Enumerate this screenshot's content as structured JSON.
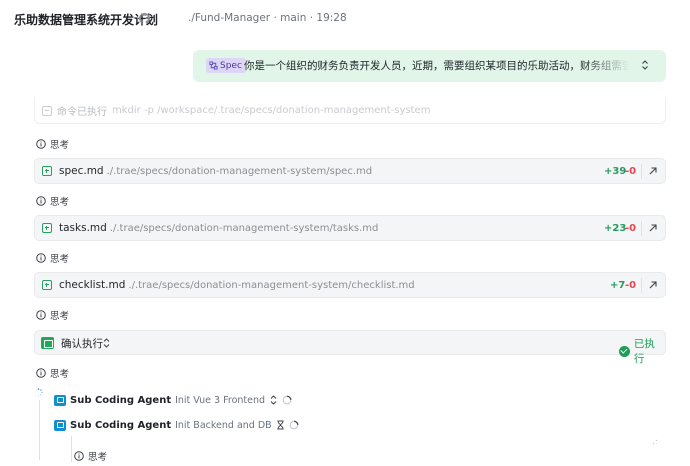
{
  "header": {
    "title": "乐助数据管理系统开发计划",
    "meta": "./Fund-Manager · main · 19:28"
  },
  "spec_message": {
    "tag": "Spec",
    "text": "你是一个组织的财务负责开发人员，近期，需要组织某项目的乐助活动，财务组需要记录"
  },
  "command": {
    "label": "命令已执行",
    "path": "mkdir -p /workspace/.trae/specs/donation-management-system"
  },
  "think_label": "思考",
  "files": [
    {
      "name": "spec.md",
      "path": "./.trae/specs/donation-management-system/spec.md",
      "added": "+39",
      "removed": "-0"
    },
    {
      "name": "tasks.md",
      "path": "./.trae/specs/donation-management-system/tasks.md",
      "added": "+23",
      "removed": "-0"
    },
    {
      "name": "checklist.md",
      "path": "./.trae/specs/donation-management-system/checklist.md",
      "added": "+7",
      "removed": "-0"
    }
  ],
  "confirm": {
    "label": "确认执行",
    "status": "已执行"
  },
  "agents": [
    {
      "name": "Sub Coding Agent",
      "task": "Init Vue 3 Frontend"
    },
    {
      "name": "Sub Coding Agent",
      "task": "Init Backend and DB"
    }
  ],
  "colors": {
    "added": "#249b5e",
    "removed": "#e0484e",
    "spec_bg": "#e1f5e9",
    "done": "#1f9d55",
    "agent_icon": "#118ecf"
  }
}
